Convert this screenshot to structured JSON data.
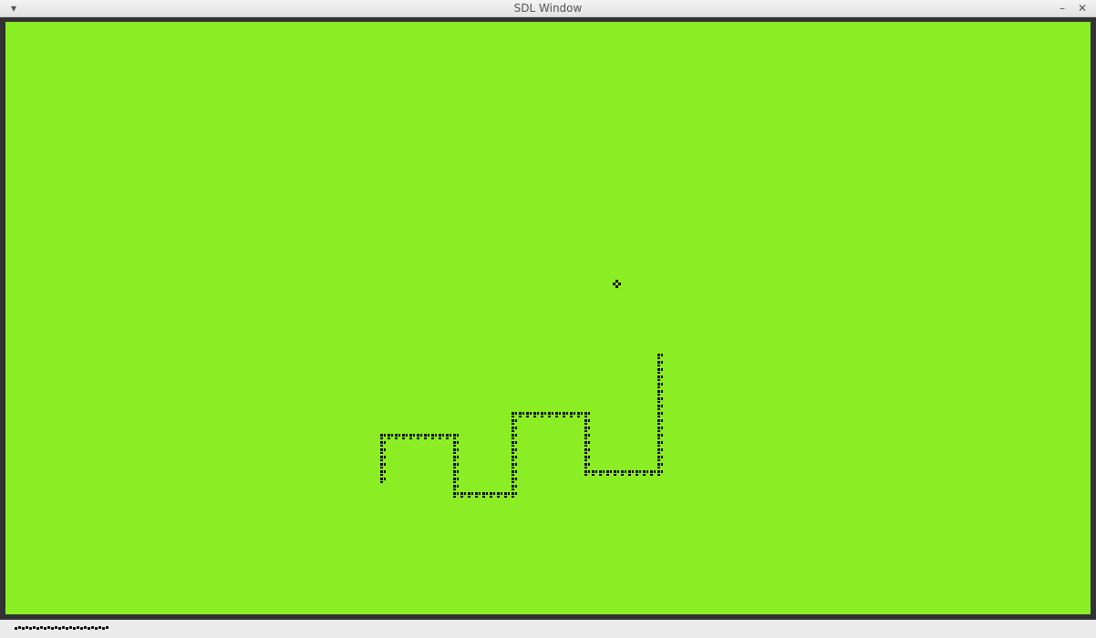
{
  "window": {
    "title": "SDL Window",
    "menu_icon": "chevron-down-icon",
    "minimize_icon": "minimize-icon",
    "close_icon": "close-icon"
  },
  "game": {
    "background_color": "#8bed24",
    "border_color": "#333333",
    "pixel_color": "#000000",
    "food": {
      "col": 84,
      "row": 36
    },
    "snake_path": [
      {
        "col": 52,
        "row": 63
      },
      {
        "col": 52,
        "row": 57
      },
      {
        "col": 62,
        "row": 57
      },
      {
        "col": 62,
        "row": 65
      },
      {
        "col": 70,
        "row": 65
      },
      {
        "col": 70,
        "row": 54
      },
      {
        "col": 80,
        "row": 54
      },
      {
        "col": 80,
        "row": 62
      },
      {
        "col": 90,
        "row": 62
      },
      {
        "col": 90,
        "row": 46
      }
    ]
  }
}
